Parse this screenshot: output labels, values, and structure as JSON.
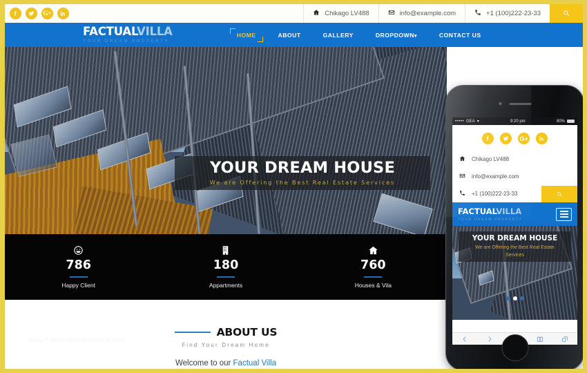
{
  "topbar": {
    "social": [
      {
        "name": "facebook",
        "glyph": "f"
      },
      {
        "name": "twitter",
        "glyph": "t"
      },
      {
        "name": "google-plus",
        "glyph": "G+"
      },
      {
        "name": "linkedin",
        "glyph": "in"
      }
    ],
    "address": "Chikago LV488",
    "email": "info@example.com",
    "phone": "+1 (100)222-23-33",
    "search_icon": "search-icon"
  },
  "brand": {
    "name_strong": "FACTUAL",
    "name_light": "VILLA",
    "tagline": "YOUR DREAM PROPERTY"
  },
  "menu": {
    "items": [
      {
        "label": "HOME",
        "active": true
      },
      {
        "label": "ABOUT",
        "active": false
      },
      {
        "label": "GALLERY",
        "active": false
      },
      {
        "label": "DROPDOWN",
        "active": false,
        "caret": "▾"
      },
      {
        "label": "CONTACT US",
        "active": false
      }
    ]
  },
  "hero": {
    "title": "YOUR DREAM HOUSE",
    "subtitle": "We are Offering the Best Real Estate Services",
    "slides": 3,
    "active_slide": 2
  },
  "stats": [
    {
      "icon": "smiley-icon",
      "number": "786",
      "label": "Happy Client"
    },
    {
      "icon": "building-icon",
      "number": "180",
      "label": "Appartments"
    },
    {
      "icon": "home-icon",
      "number": "760",
      "label": "Houses & Vila"
    }
  ],
  "about": {
    "title": "ABOUT US",
    "subtitle": "Find Your Dream Home",
    "body_prefix": "Welcome to our ",
    "body_link": "Factual Villa",
    "watermark": "www.freetemplateexample.com"
  },
  "phone": {
    "status": {
      "signal": "•••••",
      "carrier": "GEA",
      "time": "9:20 pm",
      "battery": "80%"
    },
    "social": [
      {
        "name": "facebook",
        "glyph": "f"
      },
      {
        "name": "twitter",
        "glyph": "t"
      },
      {
        "name": "google-plus",
        "glyph": "G+"
      },
      {
        "name": "linkedin",
        "glyph": "in"
      }
    ],
    "address": "Chikago LV488",
    "email": "info@example.com",
    "phone_number": "+1 (100)222-23-33",
    "brand_strong": "FACTUAL",
    "brand_light": "VILLA",
    "brand_tagline": "YOUR DREAM PROPERTY",
    "hero_title": "YOUR DREAM HOUSE",
    "hero_subtitle": "We are Offering the Best Real Estate Services",
    "slides": 3,
    "active_slide": 2,
    "browser_buttons": [
      "back-icon",
      "forward-icon",
      "share-icon",
      "bookmarks-icon",
      "tabs-icon"
    ]
  },
  "colors": {
    "brand_blue": "#1173ce",
    "accent_yellow": "#f5c518",
    "frame_yellow": "#e8d14a",
    "dark_panel": "#050505",
    "caption_gold": "#c9a84e"
  }
}
